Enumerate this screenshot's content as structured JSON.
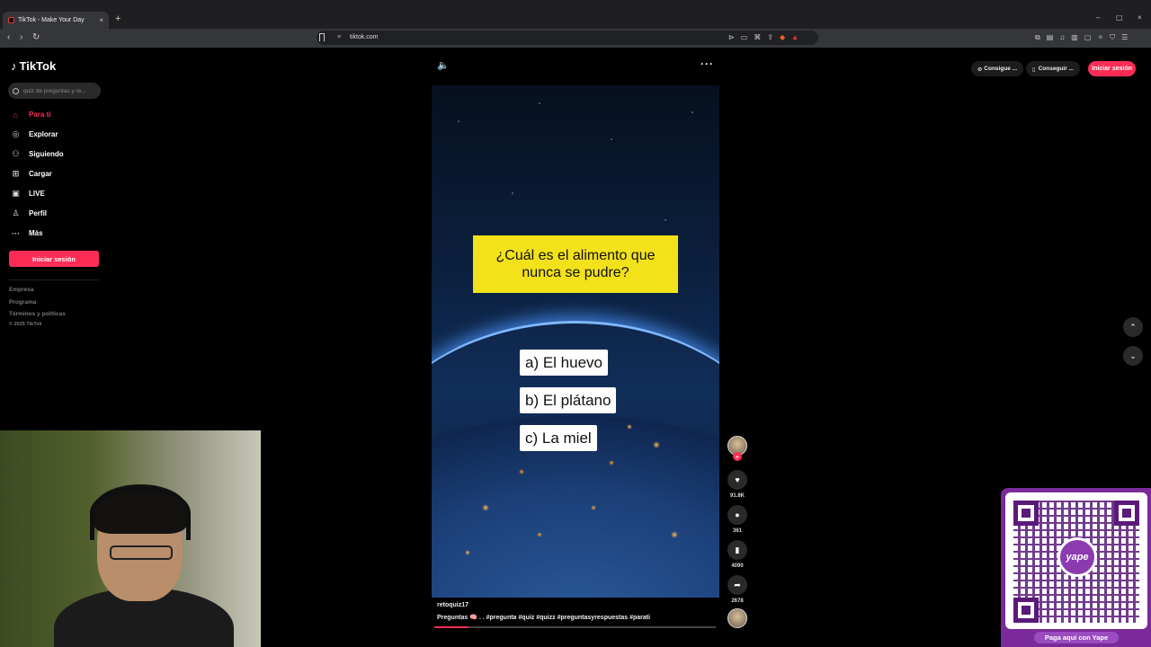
{
  "browser": {
    "tab_title": "TikTok - Make Your Day",
    "tab_close": "×",
    "new_tab": "+",
    "url": "tiktok.com",
    "window_controls": [
      "–",
      "▢",
      "×"
    ]
  },
  "sidebar": {
    "logo": "TikTok",
    "search_placeholder": "quiz de preguntas y re...",
    "items": [
      {
        "label": "Para ti",
        "icon": "home-icon",
        "glyph": "⌂"
      },
      {
        "label": "Explorar",
        "icon": "compass-icon",
        "glyph": "◎"
      },
      {
        "label": "Siguiendo",
        "icon": "following-icon",
        "glyph": "⚇"
      },
      {
        "label": "Cargar",
        "icon": "upload-icon",
        "glyph": "⊞"
      },
      {
        "label": "LIVE",
        "icon": "live-icon",
        "glyph": "▣"
      },
      {
        "label": "Perfil",
        "icon": "profile-icon",
        "glyph": "♙"
      },
      {
        "label": "Más",
        "icon": "more-icon",
        "glyph": "···"
      }
    ],
    "login_button": "Iniciar sesión",
    "footer": [
      "Empresa",
      "Programa",
      "Términos y políticas",
      "© 2025 TikTok"
    ]
  },
  "header": {
    "pill1": "Consigue ...",
    "pill2": "Conseguir ...",
    "login": "Iniciar sesión"
  },
  "video": {
    "question": "¿Cuál es el alimento que nunca se pudre?",
    "answers": [
      "a) El huevo",
      "b) El plátano",
      "c) La miel"
    ],
    "username": "retoquiz17",
    "caption": "Preguntas 🧠 . . #pregunta #quiz #quizz #preguntasyrespuestas #parati",
    "progress": 0.12
  },
  "actions": {
    "likes": "91.8K",
    "comments": "361",
    "saves": "4090",
    "shares": "2678"
  },
  "qr": {
    "brand": "yape",
    "label": "Paga aquí con Yape"
  },
  "colors": {
    "accent": "#fe2c55",
    "question_bg": "#f3e21a",
    "yape": "#7a2a9a"
  }
}
